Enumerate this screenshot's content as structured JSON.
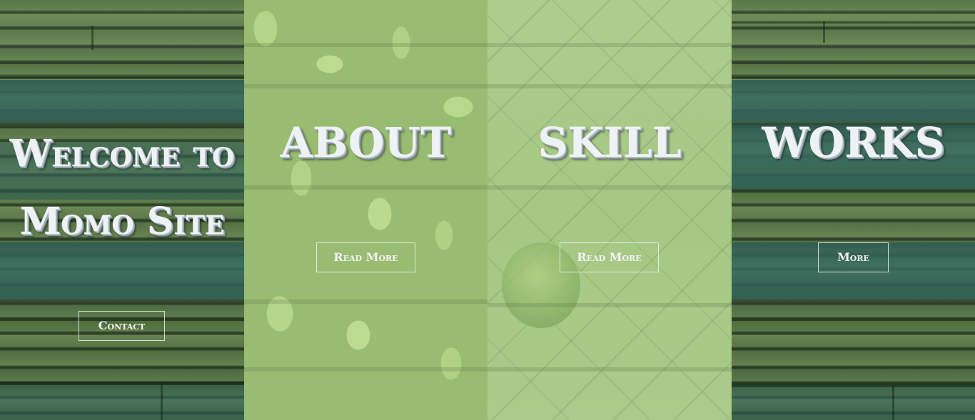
{
  "panels": {
    "welcome": {
      "title_line1": "Welcome to",
      "title_line2": "Momo Site",
      "button": "Contact"
    },
    "about": {
      "title": "ABOUT",
      "button": "Read More"
    },
    "skill": {
      "title": "SKILL",
      "button": "Read More"
    },
    "works": {
      "title": "WORKS",
      "button": "More"
    }
  },
  "colors": {
    "title_text": "#eef2f4",
    "button_border": "#f0f0f0",
    "stone_teal": "#2c5a52",
    "cucumber_green": "#b9d98c",
    "wood_green": "#a7c98a"
  }
}
